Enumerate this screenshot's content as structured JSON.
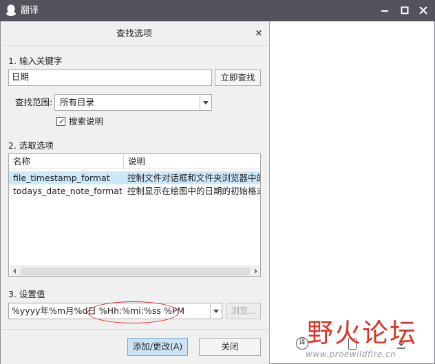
{
  "window": {
    "title": "翻译",
    "min_glyph": "—",
    "max_glyph": "□",
    "close_glyph": "✕"
  },
  "dialog": {
    "title": "查找选项",
    "close_glyph": "×",
    "section1_label": "1. 输入关键字",
    "keyword_value": "日期",
    "search_now_label": "立即查找",
    "scope_label": "查找范围:",
    "scope_value": "所有目录",
    "search_desc_label": "搜索说明",
    "search_desc_checked": true,
    "section2_label": "2. 选取选项",
    "table": {
      "columns": [
        "名称",
        "说明"
      ],
      "rows": [
        {
          "name": "file_timestamp_format",
          "desc": "控制文件对话框和文件夹浏览器中的",
          "selected": true
        },
        {
          "name": "todays_date_note_format",
          "desc": "控制显示在绘图中的日期的初始格式",
          "selected": false
        }
      ]
    },
    "section3_label": "3. 设置值",
    "setting_value": "%yyyy年%m月%d日 %Hh:%mi:%ss %PM",
    "browse_label": "浏览...",
    "add_change_label": "添加/更改(A)",
    "close_label": "关闭"
  },
  "watermark": {
    "main_text": "野火论坛",
    "url": "www.proewildfire.cn",
    "circle_glyph": "译"
  },
  "colors": {
    "titlebar": "#55525b",
    "selection": "#cde8fb",
    "annotation": "#d9302b",
    "watermark_red": "#d8362c"
  }
}
